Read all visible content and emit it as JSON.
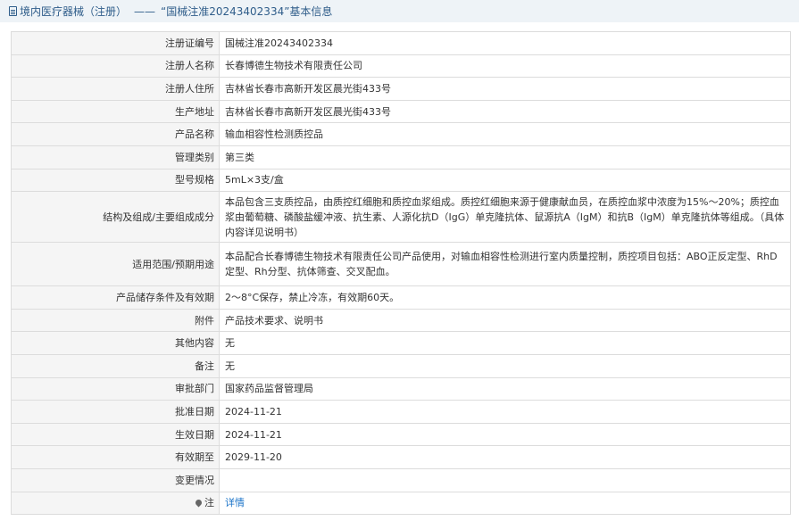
{
  "header": {
    "section": "境内医疗器械（注册）",
    "separator": "——",
    "title": "“国械注准20243402334”基本信息"
  },
  "rows": [
    {
      "label": "注册证编号",
      "value": "国械注准20243402334"
    },
    {
      "label": "注册人名称",
      "value": "长春博德生物技术有限责任公司"
    },
    {
      "label": "注册人住所",
      "value": "吉林省长春市高新开发区晨光街433号"
    },
    {
      "label": "生产地址",
      "value": "吉林省长春市高新开发区晨光街433号"
    },
    {
      "label": "产品名称",
      "value": "输血相容性检测质控品"
    },
    {
      "label": "管理类别",
      "value": "第三类"
    },
    {
      "label": "型号规格",
      "value": "5mL×3支/盒"
    },
    {
      "label": "结构及组成/主要组成成分",
      "value": "本品包含三支质控品，由质控红细胞和质控血浆组成。质控红细胞来源于健康献血员，在质控血浆中浓度为15%～20%；质控血浆由葡萄糖、磷酸盐缓冲液、抗生素、人源化抗D（IgG）单克隆抗体、鼠源抗A（IgM）和抗B（IgM）单克隆抗体等组成。（具体内容详见说明书）"
    },
    {
      "label": "适用范围/预期用途",
      "value": "本品配合长春博德生物技术有限责任公司产品使用，对输血相容性检测进行室内质量控制，质控项目包括：ABO正反定型、RhD定型、Rh分型、抗体筛查、交叉配血。"
    },
    {
      "label": "产品储存条件及有效期",
      "value": "2～8°C保存，禁止冷冻，有效期60天。"
    },
    {
      "label": "附件",
      "value": "产品技术要求、说明书"
    },
    {
      "label": "其他内容",
      "value": "无"
    },
    {
      "label": "备注",
      "value": "无"
    },
    {
      "label": "审批部门",
      "value": "国家药品监督管理局"
    },
    {
      "label": "批准日期",
      "value": "2024-11-21"
    },
    {
      "label": "生效日期",
      "value": "2024-11-21"
    },
    {
      "label": "有效期至",
      "value": "2029-11-20"
    },
    {
      "label": "变更情况",
      "value": ""
    }
  ],
  "note": {
    "label": "注",
    "link_text": "详情",
    "icon": "pin-icon"
  }
}
